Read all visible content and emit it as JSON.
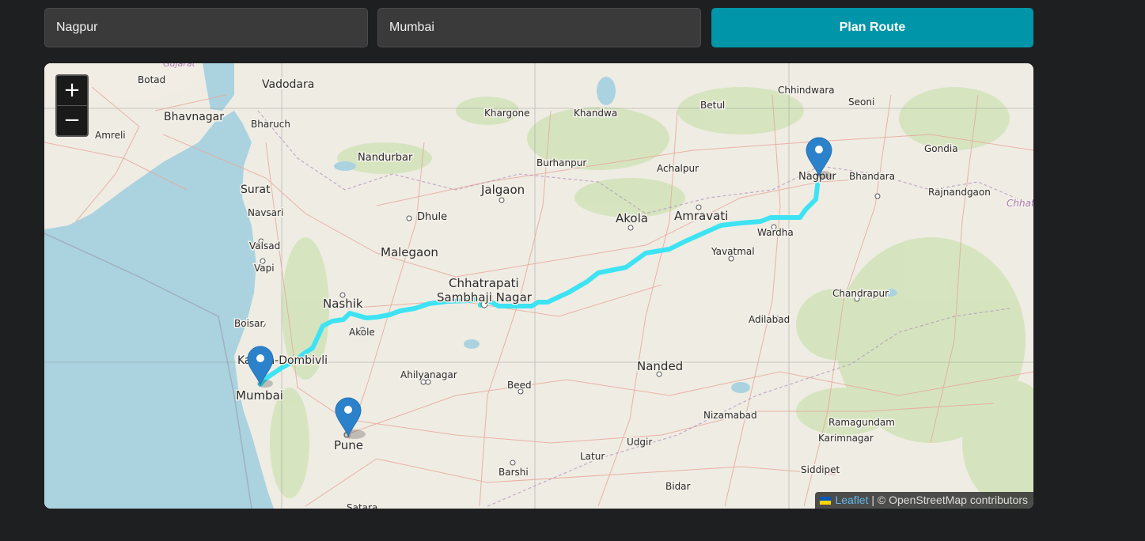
{
  "form": {
    "from_value": "Nagpur",
    "to_value": "Mumbai",
    "plan_button_label": "Plan Route"
  },
  "map": {
    "zoom_in_label": "+",
    "zoom_out_label": "−",
    "attribution_link": "Leaflet",
    "attribution_text": " | © OpenStreetMap contributors",
    "route_color": "#3de3f2",
    "markers": [
      "Nagpur",
      "Mumbai",
      "Pune"
    ],
    "places": [
      "Gujarat",
      "Botad",
      "Vadodara",
      "Bhavnagar",
      "Amreli",
      "Bharuch",
      "Surat",
      "Navsari",
      "Valsad",
      "Vapi",
      "Boisar",
      "Kalyan-Dombivli",
      "Mumbai",
      "Pune",
      "Nashik",
      "Akole",
      "Ahilyanagar",
      "Nandurbar",
      "Dhule",
      "Malegaon",
      "Jalgaon",
      "Khargone",
      "Khandwa",
      "Burhanpur",
      "Betul",
      "Chhindwara",
      "Seoni",
      "Achalpur",
      "Akola",
      "Amravati",
      "Nagpur",
      "Bhandara",
      "Gondia",
      "Rajnandgaon",
      "Wardha",
      "Yavatmal",
      "Chandrapur",
      "Adilabad",
      "Chhatrapati",
      "Sambhaji Nagar",
      "Beed",
      "Nanded",
      "Nizamabad",
      "Ramagundam",
      "Karimnagar",
      "Udgir",
      "Latur",
      "Barshi",
      "Bidar",
      "Siddipet",
      "Satara",
      "Chhatt"
    ]
  }
}
